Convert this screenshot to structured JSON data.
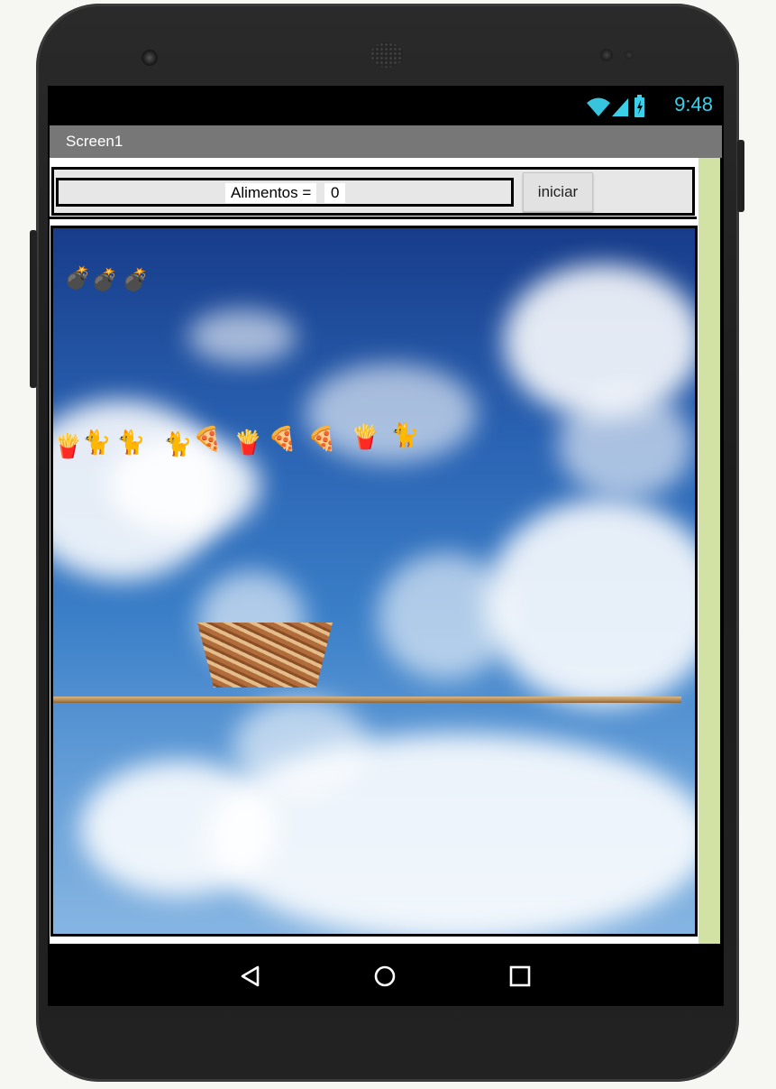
{
  "status_bar": {
    "time": "9:48",
    "icons": [
      "wifi-icon",
      "signal-icon",
      "battery-charging-icon"
    ]
  },
  "titlebar": {
    "title": "Screen1"
  },
  "controls": {
    "food_label": "Alimentos =",
    "food_count": "0",
    "start_button": "iniciar"
  },
  "game": {
    "lives_icons": [
      "bomb-icon",
      "bomb-icon",
      "bomb-icon"
    ],
    "falling_items": [
      "fries",
      "cat",
      "cat",
      "cat",
      "pizza",
      "fries",
      "pizza",
      "pizza",
      "fries",
      "cat"
    ],
    "catcher": "basket",
    "platform": "wooden-plank"
  },
  "nav_bar": {
    "buttons": [
      "back-icon",
      "home-icon",
      "recents-icon"
    ]
  },
  "colors": {
    "status_clock": "#3ad0ea",
    "titlebar": "#777777",
    "right_strip": "#d2e2a4"
  }
}
